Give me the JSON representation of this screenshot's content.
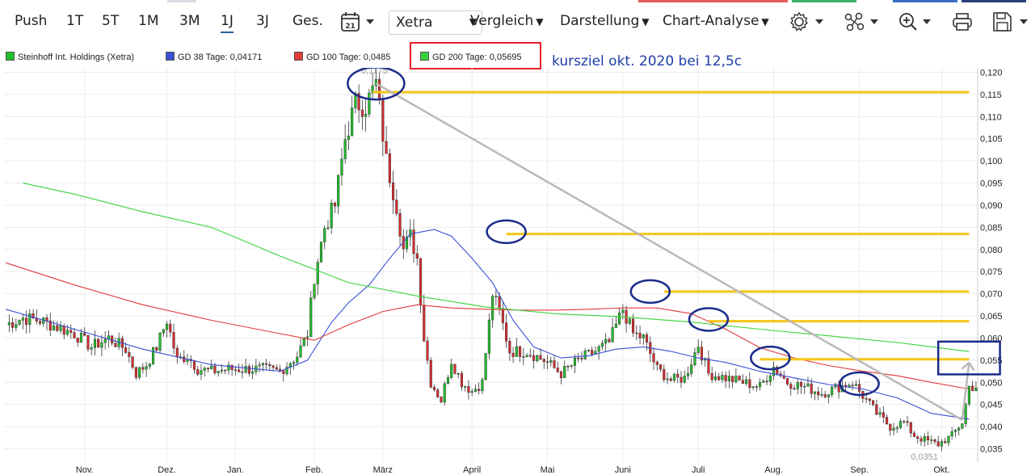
{
  "toolbar": {
    "periods": [
      "Push",
      "1T",
      "5T",
      "1M",
      "3M",
      "1J",
      "3J",
      "Ges."
    ],
    "active_period": "1J",
    "calendar_day": "21",
    "exchange": "Xetra",
    "menus": [
      "Vergleich",
      "Darstellung",
      "Chart-Analyse"
    ],
    "icons": [
      "gear-icon",
      "indicator-icon",
      "zoom-icon",
      "print-icon",
      "save-icon"
    ]
  },
  "legend": {
    "main": "Steinhoff Int. Holdings (Xetra)",
    "gd38": "GD 38 Tage: 0,04171",
    "gd100": "GD 100 Tage: 0,0485",
    "gd200": "GD 200 Tage: 0,05695"
  },
  "annotation": "kursziel okt. 2020 bei 12,5c",
  "colors": {
    "up": "#1fbf2a",
    "down": "#d92d2d",
    "gd38": "#3a4fd6",
    "gd100": "#e03a3a",
    "gd200": "#38d338",
    "marker": "#f5c518",
    "ellipse": "#1b2b8a",
    "trend": "#b9b9b9"
  },
  "chart_data": {
    "type": "candlestick",
    "title": "",
    "xlabel": "",
    "ylabel": "",
    "ylim": [
      0.032,
      0.121
    ],
    "y_ticks": [
      "0,120",
      "0,115",
      "0,110",
      "0,105",
      "0,100",
      "0,095",
      "0,090",
      "0,085",
      "0,080",
      "0,075",
      "0,070",
      "0,065",
      "0,060",
      "0,055",
      "0,050",
      "0,045",
      "0,040",
      "0,035"
    ],
    "x_labels": [
      {
        "label": "Nov.",
        "day": 23
      },
      {
        "label": "Dez.",
        "day": 47
      },
      {
        "label": "Jan.",
        "day": 67
      },
      {
        "label": "Feb.",
        "day": 90
      },
      {
        "label": "März",
        "day": 110
      },
      {
        "label": "April",
        "day": 136
      },
      {
        "label": "Mai",
        "day": 158
      },
      {
        "label": "Juni",
        "day": 180
      },
      {
        "label": "Juli",
        "day": 202
      },
      {
        "label": "Aug.",
        "day": 224
      },
      {
        "label": "Sep.",
        "day": 249
      },
      {
        "label": "Okt.",
        "day": 273
      }
    ],
    "days": 284,
    "high_label": "0,1175",
    "low_label": "0,0351",
    "anchors": [
      [
        0,
        0.063
      ],
      [
        5,
        0.0645
      ],
      [
        10,
        0.064
      ],
      [
        15,
        0.0625
      ],
      [
        20,
        0.061
      ],
      [
        25,
        0.058
      ],
      [
        30,
        0.06
      ],
      [
        35,
        0.0575
      ],
      [
        38,
        0.052
      ],
      [
        41,
        0.054
      ],
      [
        44,
        0.058
      ],
      [
        47,
        0.064
      ],
      [
        50,
        0.055
      ],
      [
        53,
        0.056
      ],
      [
        56,
        0.053
      ],
      [
        60,
        0.0525
      ],
      [
        65,
        0.053
      ],
      [
        70,
        0.053
      ],
      [
        75,
        0.053
      ],
      [
        80,
        0.0525
      ],
      [
        85,
        0.056
      ],
      [
        88,
        0.061
      ],
      [
        90,
        0.074
      ],
      [
        93,
        0.085
      ],
      [
        96,
        0.09
      ],
      [
        99,
        0.105
      ],
      [
        102,
        0.113
      ],
      [
        105,
        0.1125
      ],
      [
        108,
        0.1175
      ],
      [
        111,
        0.1
      ],
      [
        114,
        0.09
      ],
      [
        116,
        0.08
      ],
      [
        118,
        0.083
      ],
      [
        120,
        0.078
      ],
      [
        122,
        0.06
      ],
      [
        124,
        0.05
      ],
      [
        127,
        0.046
      ],
      [
        130,
        0.055
      ],
      [
        133,
        0.05
      ],
      [
        136,
        0.048
      ],
      [
        139,
        0.05
      ],
      [
        142,
        0.07
      ],
      [
        144,
        0.066
      ],
      [
        147,
        0.057
      ],
      [
        152,
        0.057
      ],
      [
        157,
        0.055
      ],
      [
        162,
        0.052
      ],
      [
        167,
        0.055
      ],
      [
        172,
        0.057
      ],
      [
        176,
        0.059
      ],
      [
        180,
        0.0665
      ],
      [
        183,
        0.061
      ],
      [
        186,
        0.06
      ],
      [
        190,
        0.053
      ],
      [
        194,
        0.0505
      ],
      [
        198,
        0.051
      ],
      [
        202,
        0.0585
      ],
      [
        205,
        0.052
      ],
      [
        210,
        0.051
      ],
      [
        215,
        0.05
      ],
      [
        220,
        0.049
      ],
      [
        224,
        0.0535
      ],
      [
        228,
        0.05
      ],
      [
        233,
        0.049
      ],
      [
        238,
        0.0475
      ],
      [
        243,
        0.049
      ],
      [
        247,
        0.05
      ],
      [
        250,
        0.047
      ],
      [
        254,
        0.043
      ],
      [
        258,
        0.04
      ],
      [
        262,
        0.041
      ],
      [
        265,
        0.038
      ],
      [
        268,
        0.037
      ],
      [
        272,
        0.036
      ],
      [
        276,
        0.038
      ],
      [
        279,
        0.041
      ],
      [
        281,
        0.049
      ]
    ],
    "series": [
      {
        "name": "GD 38 Tage",
        "color": "#3a4fd6",
        "points": [
          [
            0,
            0.0665
          ],
          [
            20,
            0.062
          ],
          [
            40,
            0.0575
          ],
          [
            60,
            0.054
          ],
          [
            80,
            0.0525
          ],
          [
            88,
            0.055
          ],
          [
            95,
            0.0635
          ],
          [
            100,
            0.068
          ],
          [
            106,
            0.072
          ],
          [
            112,
            0.078
          ],
          [
            118,
            0.0835
          ],
          [
            125,
            0.0845
          ],
          [
            130,
            0.083
          ],
          [
            136,
            0.078
          ],
          [
            142,
            0.0725
          ],
          [
            148,
            0.064
          ],
          [
            154,
            0.058
          ],
          [
            162,
            0.0555
          ],
          [
            170,
            0.056
          ],
          [
            178,
            0.0575
          ],
          [
            186,
            0.058
          ],
          [
            194,
            0.057
          ],
          [
            202,
            0.0555
          ],
          [
            210,
            0.0545
          ],
          [
            220,
            0.0525
          ],
          [
            230,
            0.051
          ],
          [
            240,
            0.0495
          ],
          [
            250,
            0.0485
          ],
          [
            260,
            0.0465
          ],
          [
            270,
            0.043
          ],
          [
            281,
            0.04171
          ]
        ]
      },
      {
        "name": "GD 100 Tage",
        "color": "#e03a3a",
        "points": [
          [
            0,
            0.077
          ],
          [
            20,
            0.072
          ],
          [
            40,
            0.0675
          ],
          [
            60,
            0.064
          ],
          [
            80,
            0.061
          ],
          [
            90,
            0.0595
          ],
          [
            100,
            0.063
          ],
          [
            110,
            0.066
          ],
          [
            120,
            0.0675
          ],
          [
            130,
            0.0668
          ],
          [
            140,
            0.0665
          ],
          [
            150,
            0.0663
          ],
          [
            160,
            0.0663
          ],
          [
            170,
            0.0665
          ],
          [
            180,
            0.0668
          ],
          [
            190,
            0.0668
          ],
          [
            200,
            0.0655
          ],
          [
            210,
            0.062
          ],
          [
            220,
            0.0578
          ],
          [
            230,
            0.0555
          ],
          [
            240,
            0.0538
          ],
          [
            250,
            0.0525
          ],
          [
            260,
            0.0515
          ],
          [
            270,
            0.05
          ],
          [
            281,
            0.0485
          ]
        ]
      },
      {
        "name": "GD 200 Tage",
        "color": "#38d338",
        "points": [
          [
            5,
            0.095
          ],
          [
            20,
            0.0925
          ],
          [
            40,
            0.0885
          ],
          [
            60,
            0.085
          ],
          [
            80,
            0.0785
          ],
          [
            100,
            0.0725
          ],
          [
            120,
            0.0695
          ],
          [
            140,
            0.067
          ],
          [
            160,
            0.0655
          ],
          [
            180,
            0.0648
          ],
          [
            200,
            0.0636
          ],
          [
            220,
            0.062
          ],
          [
            240,
            0.0605
          ],
          [
            260,
            0.059
          ],
          [
            281,
            0.05695
          ]
        ]
      }
    ],
    "resistance_lines": [
      {
        "y": 0.1155,
        "x0": 107,
        "x1": 281
      },
      {
        "y": 0.0835,
        "x0": 146,
        "x1": 281
      },
      {
        "y": 0.0705,
        "x0": 192,
        "x1": 281
      },
      {
        "y": 0.0638,
        "x0": 205,
        "x1": 281
      },
      {
        "y": 0.0552,
        "x0": 220,
        "x1": 281
      }
    ],
    "trend_lines": [
      {
        "x0": 108,
        "y0": 0.1175,
        "x1": 279,
        "y1": 0.0415
      },
      {
        "x0": 279,
        "y0": 0.0415,
        "x1": 281,
        "y1": 0.0545
      }
    ],
    "ellipses": [
      {
        "x": 108,
        "y": 0.1175
      },
      {
        "x": 146,
        "y": 0.084
      },
      {
        "x": 188,
        "y": 0.0705
      },
      {
        "x": 205,
        "y": 0.0642
      },
      {
        "x": 223,
        "y": 0.0555
      },
      {
        "x": 249,
        "y": 0.0497
      }
    ],
    "target_box": {
      "x0": 272,
      "x1": 290,
      "y0": 0.0592,
      "y1": 0.0518
    }
  }
}
